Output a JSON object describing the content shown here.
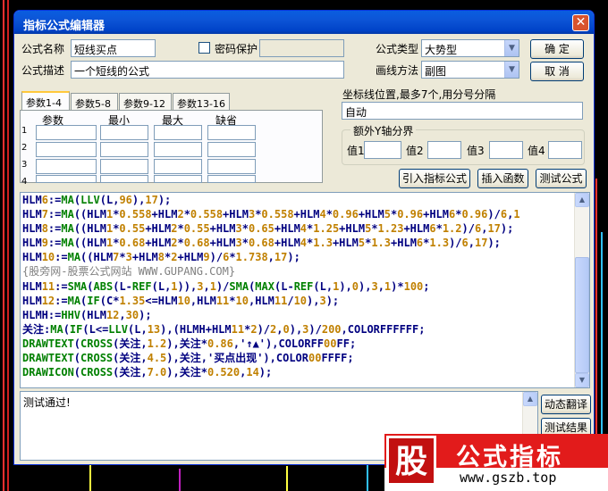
{
  "window": {
    "title": "指标公式编辑器"
  },
  "form": {
    "name_label": "公式名称",
    "name_value": "短线买点",
    "password_label": "密码保护",
    "desc_label": "公式描述",
    "desc_value": "一个短线的公式",
    "type_label": "公式类型",
    "type_value": "大势型",
    "draw_label": "画线方法",
    "draw_value": "副图",
    "ok_label": "确  定",
    "cancel_label": "取  消"
  },
  "params": {
    "tabs": [
      "参数1-4",
      "参数5-8",
      "参数9-12",
      "参数13-16"
    ],
    "headers": [
      "参数",
      "最小",
      "最大",
      "缺省"
    ],
    "rows": [
      "1",
      "2",
      "3",
      "4"
    ]
  },
  "coords": {
    "label": "坐标线位置,最多7个,用分号分隔",
    "value": "自动"
  },
  "yaxis": {
    "legend": "额外Y轴分界",
    "labels": [
      "值1",
      "值2",
      "值3",
      "值4"
    ]
  },
  "actions": {
    "import_label": "引入指标公式",
    "insert_label": "插入函数",
    "test_label": "测试公式"
  },
  "code_lines": [
    "HLM6:=MA(LLV(L,96),17);",
    "HLM7:=MA((HLM1*0.558+HLM2*0.558+HLM3*0.558+HLM4*0.96+HLM5*0.96+HLM6*0.96)/6,1",
    "HLM8:=MA((HLM1*0.55+HLM2*0.55+HLM3*0.65+HLM4*1.25+HLM5*1.23+HLM6*1.2)/6,17);",
    "HLM9:=MA((HLM1*0.68+HLM2*0.68+HLM3*0.68+HLM4*1.3+HLM5*1.3+HLM6*1.3)/6,17);",
    "HLM10:=MA((HLM7*3+HLM8*2+HLM9)/6*1.738,17);",
    "{股旁网-股票公式网站 WWW.GUPANG.COM}",
    "HLM11:=SMA(ABS(L-REF(L,1)),3,1)/SMA(MAX(L-REF(L,1),0),3,1)*100;",
    "HLM12:=MA(IF(C*1.35<=HLM10,HLM11*10,HLM11/10),3);",
    "HLMH:=HHV(HLM12,30);",
    "关注:MA(IF(L<=LLV(L,13),(HLMH+HLM11*2)/2,0),3)/200,COLORFFFFFF;",
    "DRAWTEXT(CROSS(关注,1.2),关注*0.86,'↑▲'),COLORFF00FF;",
    "DRAWTEXT(CROSS(关注,4.5),关注,'买点出现'),COLOR00FFFF;",
    "DRAWICON(CROSS(关注,7.0),关注*0.520,14);"
  ],
  "output": {
    "text": "测试通过!"
  },
  "side_buttons": {
    "translate_label": "动态翻译",
    "result_label": "测试结果"
  },
  "watermark": {
    "glyph": "股",
    "title": "公式指标",
    "url": "www.gszb.top"
  },
  "colors": {
    "title_bar": "#0054e3",
    "code_text": "#000080",
    "keyword": "#008000",
    "number": "#c08000",
    "comment": "#808080",
    "logo_red": "#e21b1b"
  }
}
